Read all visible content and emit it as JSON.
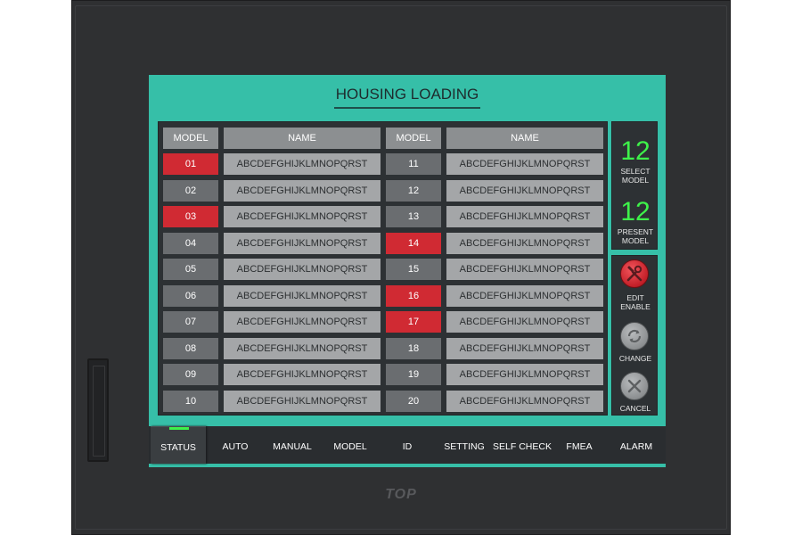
{
  "screen": {
    "title": "HOUSING LOADING",
    "brand": "TOP"
  },
  "table": {
    "headers": {
      "model": "MODEL",
      "name": "NAME"
    },
    "left_rows": [
      {
        "model": "01",
        "name": "ABCDEFGHIJKLMNOPQRST",
        "active": true
      },
      {
        "model": "02",
        "name": "ABCDEFGHIJKLMNOPQRST",
        "active": false
      },
      {
        "model": "03",
        "name": "ABCDEFGHIJKLMNOPQRST",
        "active": true
      },
      {
        "model": "04",
        "name": "ABCDEFGHIJKLMNOPQRST",
        "active": false
      },
      {
        "model": "05",
        "name": "ABCDEFGHIJKLMNOPQRST",
        "active": false
      },
      {
        "model": "06",
        "name": "ABCDEFGHIJKLMNOPQRST",
        "active": false
      },
      {
        "model": "07",
        "name": "ABCDEFGHIJKLMNOPQRST",
        "active": false
      },
      {
        "model": "08",
        "name": "ABCDEFGHIJKLMNOPQRST",
        "active": false
      },
      {
        "model": "09",
        "name": "ABCDEFGHIJKLMNOPQRST",
        "active": false
      },
      {
        "model": "10",
        "name": "ABCDEFGHIJKLMNOPQRST",
        "active": false
      }
    ],
    "right_rows": [
      {
        "model": "11",
        "name": "ABCDEFGHIJKLMNOPQRST",
        "active": false
      },
      {
        "model": "12",
        "name": "ABCDEFGHIJKLMNOPQRST",
        "active": false
      },
      {
        "model": "13",
        "name": "ABCDEFGHIJKLMNOPQRST",
        "active": false
      },
      {
        "model": "14",
        "name": "ABCDEFGHIJKLMNOPQRST",
        "active": true
      },
      {
        "model": "15",
        "name": "ABCDEFGHIJKLMNOPQRST",
        "active": false
      },
      {
        "model": "16",
        "name": "ABCDEFGHIJKLMNOPQRST",
        "active": true
      },
      {
        "model": "17",
        "name": "ABCDEFGHIJKLMNOPQRST",
        "active": true
      },
      {
        "model": "18",
        "name": "ABCDEFGHIJKLMNOPQRST",
        "active": false
      },
      {
        "model": "19",
        "name": "ABCDEFGHIJKLMNOPQRST",
        "active": false
      },
      {
        "model": "20",
        "name": "ABCDEFGHIJKLMNOPQRST",
        "active": false
      }
    ]
  },
  "side": {
    "select_model_value": "12",
    "select_model_label_1": "SELECT",
    "select_model_label_2": "MODEL",
    "present_model_value": "12",
    "present_model_label_1": "PRESENT",
    "present_model_label_2": "MODEL",
    "edit_label_1": "EDIT",
    "edit_label_2": "ENABLE",
    "change_label": "CHANGE",
    "cancel_label": "CANCEL",
    "edit_icon": "tools-icon",
    "change_icon": "refresh-icon",
    "cancel_icon": "close-icon"
  },
  "tabs": [
    "STATUS",
    "AUTO",
    "MANUAL",
    "MODEL",
    "ID",
    "SETTING",
    "SELF CHECK",
    "FMEA",
    "ALARM"
  ],
  "active_tab": "STATUS",
  "colors": {
    "screen_bg": "#36bfa8",
    "active_cell": "#d02a33",
    "indicator_green": "#3ef24a"
  }
}
